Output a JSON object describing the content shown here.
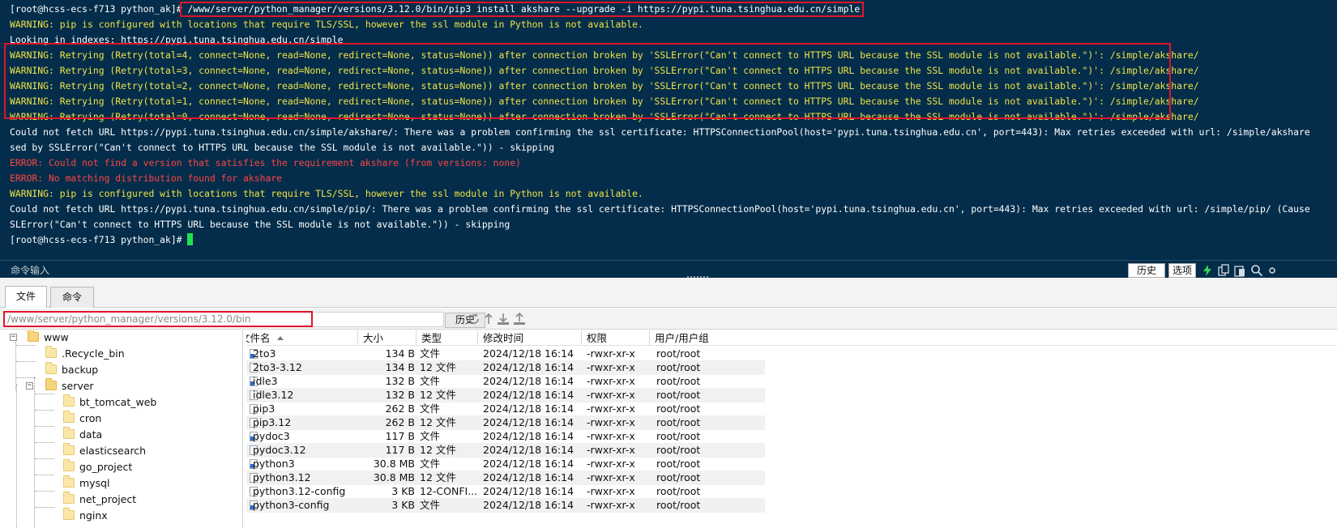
{
  "terminal": {
    "lines": [
      {
        "text": "[root@hcss-ecs-f713 python_ak]# /www/server/python_manager/versions/3.12.0/bin/pip3 install akshare --upgrade -i https://pypi.tuna.tsinghua.edu.cn/simple",
        "type": "normal"
      },
      {
        "text": "WARNING: pip is configured with locations that require TLS/SSL, however the ssl module in Python is not available.",
        "type": "warning"
      },
      {
        "text": "Looking in indexes: https://pypi.tuna.tsinghua.edu.cn/simple",
        "type": "normal"
      },
      {
        "text": "WARNING: Retrying (Retry(total=4, connect=None, read=None, redirect=None, status=None)) after connection broken by 'SSLError(\"Can't connect to HTTPS URL because the SSL module is not available.\")': /simple/akshare/",
        "type": "warning"
      },
      {
        "text": "WARNING: Retrying (Retry(total=3, connect=None, read=None, redirect=None, status=None)) after connection broken by 'SSLError(\"Can't connect to HTTPS URL because the SSL module is not available.\")': /simple/akshare/",
        "type": "warning"
      },
      {
        "text": "WARNING: Retrying (Retry(total=2, connect=None, read=None, redirect=None, status=None)) after connection broken by 'SSLError(\"Can't connect to HTTPS URL because the SSL module is not available.\")': /simple/akshare/",
        "type": "warning"
      },
      {
        "text": "WARNING: Retrying (Retry(total=1, connect=None, read=None, redirect=None, status=None)) after connection broken by 'SSLError(\"Can't connect to HTTPS URL because the SSL module is not available.\")': /simple/akshare/",
        "type": "warning"
      },
      {
        "text": "WARNING: Retrying (Retry(total=0, connect=None, read=None, redirect=None, status=None)) after connection broken by 'SSLError(\"Can't connect to HTTPS URL because the SSL module is not available.\")': /simple/akshare/",
        "type": "warning"
      },
      {
        "text": "Could not fetch URL https://pypi.tuna.tsinghua.edu.cn/simple/akshare/: There was a problem confirming the ssl certificate: HTTPSConnectionPool(host='pypi.tuna.tsinghua.edu.cn', port=443): Max retries exceeded with url: /simple/akshare",
        "type": "normal"
      },
      {
        "text": "sed by SSLError(\"Can't connect to HTTPS URL because the SSL module is not available.\")) - skipping",
        "type": "normal"
      },
      {
        "text": "ERROR: Could not find a version that satisfies the requirement akshare (from versions: none)",
        "type": "error"
      },
      {
        "text": "ERROR: No matching distribution found for akshare",
        "type": "error"
      },
      {
        "text": "WARNING: pip is configured with locations that require TLS/SSL, however the ssl module in Python is not available.",
        "type": "warning"
      },
      {
        "text": "Could not fetch URL https://pypi.tuna.tsinghua.edu.cn/simple/pip/: There was a problem confirming the ssl certificate: HTTPSConnectionPool(host='pypi.tuna.tsinghua.edu.cn', port=443): Max retries exceeded with url: /simple/pip/ (Cause",
        "type": "normal"
      },
      {
        "text": "SLError(\"Can't connect to HTTPS URL because the SSL module is not available.\")) - skipping",
        "type": "normal"
      },
      {
        "text": "[root@hcss-ecs-f713 python_ak]# ",
        "type": "normal",
        "cursor": true
      }
    ],
    "command_input_label": "命令输入",
    "history_button": "历史",
    "options_button": "选项"
  },
  "tabs": [
    {
      "label": "文件",
      "active": true
    },
    {
      "label": "命令",
      "active": false
    }
  ],
  "path_bar": {
    "path": "/www/server/python_manager/versions/3.12.0/bin",
    "history_button": "历史"
  },
  "tree": [
    {
      "label": "www",
      "depth": 0,
      "expander": "−"
    },
    {
      "label": ".Recycle_bin",
      "depth": 1
    },
    {
      "label": "backup",
      "depth": 1
    },
    {
      "label": "server",
      "depth": 1,
      "expander": "−"
    },
    {
      "label": "bt_tomcat_web",
      "depth": 2
    },
    {
      "label": "cron",
      "depth": 2
    },
    {
      "label": "data",
      "depth": 2
    },
    {
      "label": "elasticsearch",
      "depth": 2
    },
    {
      "label": "go_project",
      "depth": 2
    },
    {
      "label": "mysql",
      "depth": 2
    },
    {
      "label": "net_project",
      "depth": 2
    },
    {
      "label": "nginx",
      "depth": 2
    }
  ],
  "file_table": {
    "columns": [
      "文件名",
      "大小",
      "类型",
      "修改时间",
      "权限",
      "用户/用户组"
    ],
    "rows": [
      {
        "name": "2to3",
        "size": "134 B",
        "type": "文件",
        "mtime": "2024/12/18 16:14",
        "perm": "-rwxr-xr-x",
        "owner": "root/root",
        "link": true
      },
      {
        "name": "2to3-3.12",
        "size": "134 B",
        "type": "12 文件",
        "mtime": "2024/12/18 16:14",
        "perm": "-rwxr-xr-x",
        "owner": "root/root",
        "link": false
      },
      {
        "name": "idle3",
        "size": "132 B",
        "type": "文件",
        "mtime": "2024/12/18 16:14",
        "perm": "-rwxr-xr-x",
        "owner": "root/root",
        "link": true
      },
      {
        "name": "idle3.12",
        "size": "132 B",
        "type": "12 文件",
        "mtime": "2024/12/18 16:14",
        "perm": "-rwxr-xr-x",
        "owner": "root/root",
        "link": false
      },
      {
        "name": "pip3",
        "size": "262 B",
        "type": "文件",
        "mtime": "2024/12/18 16:14",
        "perm": "-rwxr-xr-x",
        "owner": "root/root",
        "link": false
      },
      {
        "name": "pip3.12",
        "size": "262 B",
        "type": "12 文件",
        "mtime": "2024/12/18 16:14",
        "perm": "-rwxr-xr-x",
        "owner": "root/root",
        "link": false
      },
      {
        "name": "pydoc3",
        "size": "117 B",
        "type": "文件",
        "mtime": "2024/12/18 16:14",
        "perm": "-rwxr-xr-x",
        "owner": "root/root",
        "link": true
      },
      {
        "name": "pydoc3.12",
        "size": "117 B",
        "type": "12 文件",
        "mtime": "2024/12/18 16:14",
        "perm": "-rwxr-xr-x",
        "owner": "root/root",
        "link": false
      },
      {
        "name": "python3",
        "size": "30.8 MB",
        "type": "文件",
        "mtime": "2024/12/18 16:14",
        "perm": "-rwxr-xr-x",
        "owner": "root/root",
        "link": true
      },
      {
        "name": "python3.12",
        "size": "30.8 MB",
        "type": "12 文件",
        "mtime": "2024/12/18 16:14",
        "perm": "-rwxr-xr-x",
        "owner": "root/root",
        "link": false
      },
      {
        "name": "python3.12-config",
        "size": "3 KB",
        "type": "12-CONFI...",
        "mtime": "2024/12/18 16:14",
        "perm": "-rwxr-xr-x",
        "owner": "root/root",
        "link": false
      },
      {
        "name": "python3-config",
        "size": "3 KB",
        "type": "文件",
        "mtime": "2024/12/18 16:14",
        "perm": "-rwxr-xr-x",
        "owner": "root/root",
        "link": true
      }
    ]
  },
  "colors": {
    "terminal_bg": "#032d4a",
    "warning": "#f0e447",
    "error": "#ff4444",
    "highlight": "#e0152b",
    "cursor": "#1ee34d"
  },
  "icons": [
    "lightning-icon",
    "copy-icon",
    "paste-icon",
    "search-icon",
    "refresh-icon",
    "up-icon",
    "download-icon",
    "upload-icon",
    "folder-icon",
    "file-icon"
  ]
}
